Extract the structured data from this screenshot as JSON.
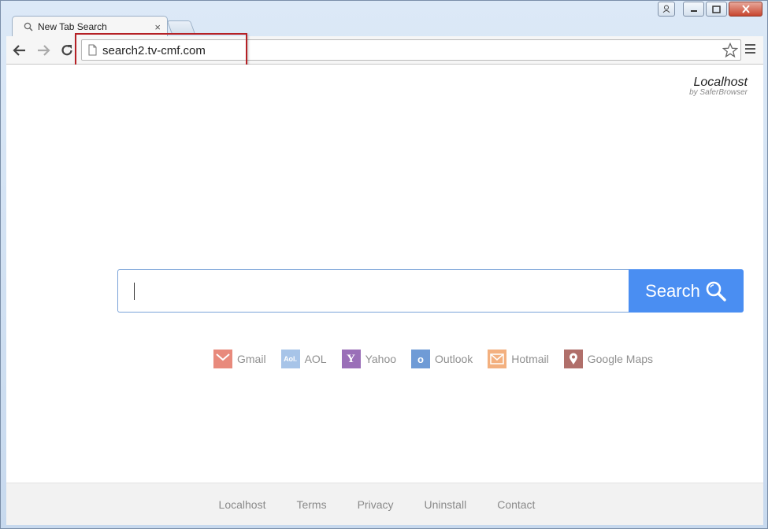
{
  "tab": {
    "title": "New Tab Search",
    "close": "×"
  },
  "toolbar": {
    "url": "search2.tv-cmf.com"
  },
  "brand": {
    "name": "Localhost",
    "by": "by SaferBrowser"
  },
  "search": {
    "button_label": "Search",
    "value": ""
  },
  "quick_links": [
    {
      "label": "Gmail",
      "icon": "gmail-icon",
      "color": "#e88a7c"
    },
    {
      "label": "AOL",
      "icon": "aol-icon",
      "glyph": "Aol.",
      "color": "#a7c4e8"
    },
    {
      "label": "Yahoo",
      "icon": "yahoo-icon",
      "glyph": "Y",
      "color": "#9a6fb8"
    },
    {
      "label": "Outlook",
      "icon": "outlook-icon",
      "glyph": "o",
      "color": "#6f9bd6"
    },
    {
      "label": "Hotmail",
      "icon": "hotmail-icon",
      "color": "#f3b07f"
    },
    {
      "label": "Google Maps",
      "icon": "map-pin-icon",
      "color": "#b06f6a"
    }
  ],
  "footer": {
    "links": [
      "Localhost",
      "Terms",
      "Privacy",
      "Uninstall",
      "Contact"
    ]
  }
}
